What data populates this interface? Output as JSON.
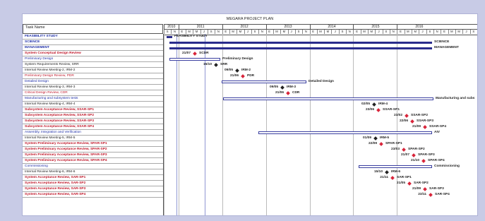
{
  "project_title": "MEGARA PROJECT PLAN",
  "task_header": "Task Name",
  "years": [
    "2010",
    "2011",
    "2012",
    "2013",
    "2014",
    "2015",
    "2016"
  ],
  "month_letters": [
    "S",
    "N",
    "E",
    "M",
    "M",
    "J",
    "S",
    "N",
    "E",
    "M",
    "M",
    "J",
    "S",
    "N",
    "E",
    "M",
    "M",
    "J",
    "S",
    "N",
    "E",
    "M",
    "M",
    "J",
    "S",
    "N",
    "E",
    "M",
    "M",
    "J",
    "S",
    "N",
    "E",
    "M",
    "M",
    "J",
    "S",
    "N",
    "E",
    "M",
    "M",
    "J",
    "S"
  ],
  "tasks": [
    {
      "label": "FEASIBILITY STUDY",
      "style": "blue bold"
    },
    {
      "label": "SCIENCE",
      "style": "blue bold"
    },
    {
      "label": "MANAGEMENT",
      "style": "blue bold"
    },
    {
      "label": "System Conceptual Design Review",
      "style": "red bold"
    },
    {
      "label": "Preliminary Design",
      "style": "blue"
    },
    {
      "label": "System Requirements Review, SRR",
      "style": "black"
    },
    {
      "label": "Internal Review Meeting-2, IRM-2",
      "style": "black"
    },
    {
      "label": "Preliminary Design Review, PDR",
      "style": "red"
    },
    {
      "label": "Detailed Design",
      "style": "blue"
    },
    {
      "label": "Internal Review Meeting-3, IRM-3",
      "style": "black"
    },
    {
      "label": "Critical Design Review, CDR",
      "style": "red"
    },
    {
      "label": "Manufacturing and subsystem tests",
      "style": "blue"
    },
    {
      "label": "Internal Review Meeting-4, IRM-4",
      "style": "black"
    },
    {
      "label": "Subsystem Acceptance Review, SSAR-SP1",
      "style": "red bold"
    },
    {
      "label": "Subsystem Acceptance Review, SSAR-SP2",
      "style": "red bold"
    },
    {
      "label": "Subsystem Acceptance Review, SSAR-SP3",
      "style": "red bold"
    },
    {
      "label": "Subsystem Acceptance Review, SSAR-SP4",
      "style": "red bold"
    },
    {
      "label": "Assembly, Integration and Verification",
      "style": "blue"
    },
    {
      "label": "Internal Review Meeting-5, IRM-5",
      "style": "black"
    },
    {
      "label": "System Preliminary Acceptance Review, SPAR-SP1",
      "style": "red bold"
    },
    {
      "label": "System Preliminary Acceptance Review, SPAR-SP2",
      "style": "red bold"
    },
    {
      "label": "System Preliminary Acceptance Review, SPAR-SP3",
      "style": "red bold"
    },
    {
      "label": "System Preliminary Acceptance Review, SPAR-SP4",
      "style": "red bold"
    },
    {
      "label": "Commissioning",
      "style": "blue"
    },
    {
      "label": "Internal Review Meeting-6, IRM-6",
      "style": "black"
    },
    {
      "label": "System Acceptance Review, SAR-SP1",
      "style": "red bold"
    },
    {
      "label": "System Acceptance Review, SAR-SP2",
      "style": "red bold"
    },
    {
      "label": "System Acceptance Review, SAR-SP3",
      "style": "red bold"
    },
    {
      "label": "System Acceptance Review, SAR-SP4",
      "style": "red bold"
    }
  ],
  "bar_labels": {
    "feasibility": "FEASIBILITY STUDY",
    "science": "SCIENCE",
    "management": "MANAGEMENT",
    "preliminary_design": "Preliminary Design",
    "detailed_design": "Detailed Design",
    "manufacturing": "Manufacturing and subs",
    "aiv": "AIV",
    "commissioning": "Commissioning"
  },
  "milestones": [
    {
      "date": "21/07",
      "name": "SCDR",
      "kind": "red"
    },
    {
      "date": "15/10",
      "name": "SRR",
      "kind": "black"
    },
    {
      "date": "09/05",
      "name": "IRM-2",
      "kind": "black"
    },
    {
      "date": "21/06",
      "name": "PDR",
      "kind": "red"
    },
    {
      "date": "09/05",
      "name": "IRM-3",
      "kind": "black"
    },
    {
      "date": "21/06",
      "name": "CDR",
      "kind": "red"
    },
    {
      "date": "02/05",
      "name": "IRM-4",
      "kind": "black"
    },
    {
      "date": "23/06",
      "name": "SSAR-SP1",
      "kind": "red"
    },
    {
      "date": "23/02",
      "name": "SSAR-SP2",
      "kind": "red"
    },
    {
      "date": "22/06",
      "name": "SSAR-SP3",
      "kind": "red"
    },
    {
      "date": "21/09",
      "name": "SSAR-SP4",
      "kind": "red"
    },
    {
      "date": "01/09",
      "name": "IRM-5",
      "kind": "black"
    },
    {
      "date": "22/09",
      "name": "SPAR-SP1",
      "kind": "red"
    },
    {
      "date": "23/03",
      "name": "SPAR-SP2",
      "kind": "red"
    },
    {
      "date": "21/07",
      "name": "SPAR-SP3",
      "kind": "red"
    },
    {
      "date": "21/10",
      "name": "SPAR-SP4",
      "kind": "red"
    },
    {
      "date": "15/10",
      "name": "IRM-6",
      "kind": "black"
    },
    {
      "date": "21/11",
      "name": "SAR-SP1",
      "kind": "red"
    },
    {
      "date": "21/05",
      "name": "SAR-SP2",
      "kind": "red"
    },
    {
      "date": "21/09",
      "name": "SAR-SP3",
      "kind": "red"
    },
    {
      "date": "23/11",
      "name": "SAR-SP4",
      "kind": "red"
    }
  ],
  "colors": {
    "background": "#c8cbe6",
    "bar": "#2a2c8c",
    "milestone_red": "#d8253a",
    "milestone_black": "#222222",
    "task_blue": "#1f2fa8",
    "task_red": "#c0182a"
  }
}
